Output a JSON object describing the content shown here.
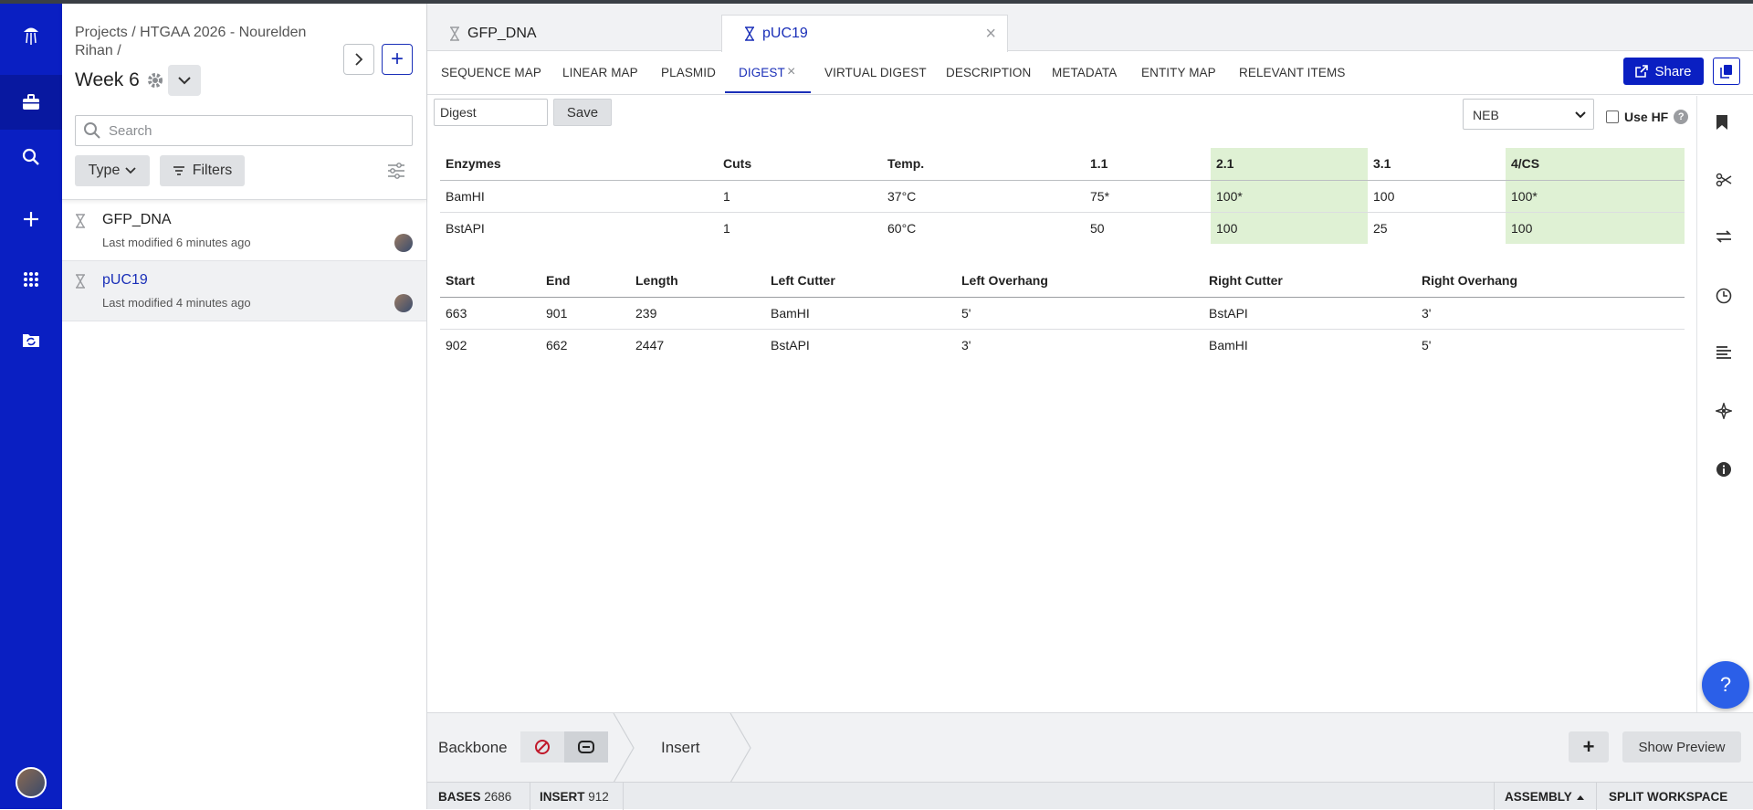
{
  "breadcrumb": "Projects / HTGAA 2026 - Nourelden Rihan /",
  "folder_title": "Week 6",
  "search": {
    "placeholder": "Search"
  },
  "filters": {
    "type_label": "Type",
    "filters_label": "Filters"
  },
  "files": [
    {
      "name": "GFP_DNA",
      "modified": "Last modified 6 minutes ago"
    },
    {
      "name": "pUC19",
      "modified": "Last modified 4 minutes ago"
    }
  ],
  "doc_tabs": [
    {
      "label": "GFP_DNA"
    },
    {
      "label": "pUC19"
    }
  ],
  "view_tabs": [
    "SEQUENCE MAP",
    "LINEAR MAP",
    "PLASMID",
    "DIGEST",
    "VIRTUAL DIGEST",
    "DESCRIPTION",
    "METADATA",
    "ENTITY MAP",
    "RELEVANT ITEMS"
  ],
  "share_label": "Share",
  "digest": {
    "name_value": "Digest",
    "save_label": "Save",
    "vendor": "NEB",
    "use_hf_label": "Use HF",
    "enzyme_headers": [
      "Enzymes",
      "Cuts",
      "Temp.",
      "1.1",
      "2.1",
      "3.1",
      "4/CS"
    ],
    "enzyme_rows": [
      [
        "BamHI",
        "1",
        "37°C",
        "75*",
        "100*",
        "100",
        "100*"
      ],
      [
        "BstAPI",
        "1",
        "60°C",
        "50",
        "100",
        "25",
        "100"
      ]
    ],
    "fragment_headers": [
      "Start",
      "End",
      "Length",
      "Left Cutter",
      "Left Overhang",
      "Right Cutter",
      "Right Overhang"
    ],
    "fragment_rows": [
      [
        "663",
        "901",
        "239",
        "BamHI",
        "5'",
        "BstAPI",
        "3'"
      ],
      [
        "902",
        "662",
        "2447",
        "BstAPI",
        "3'",
        "BamHI",
        "5'"
      ]
    ]
  },
  "assembly": {
    "backbone_label": "Backbone",
    "insert_label": "Insert",
    "preview_label": "Show Preview"
  },
  "status": {
    "bases_label": "BASES",
    "bases_value": "2686",
    "insert_label": "INSERT",
    "insert_value": "912",
    "assembly_label": "ASSEMBLY",
    "split_label": "SPLIT WORKSPACE"
  },
  "help_fab_label": "?",
  "colors": {
    "brand": "#0a1fc2",
    "accent": "#1a2fb8",
    "buffer_highlight": "#dff1d4"
  }
}
